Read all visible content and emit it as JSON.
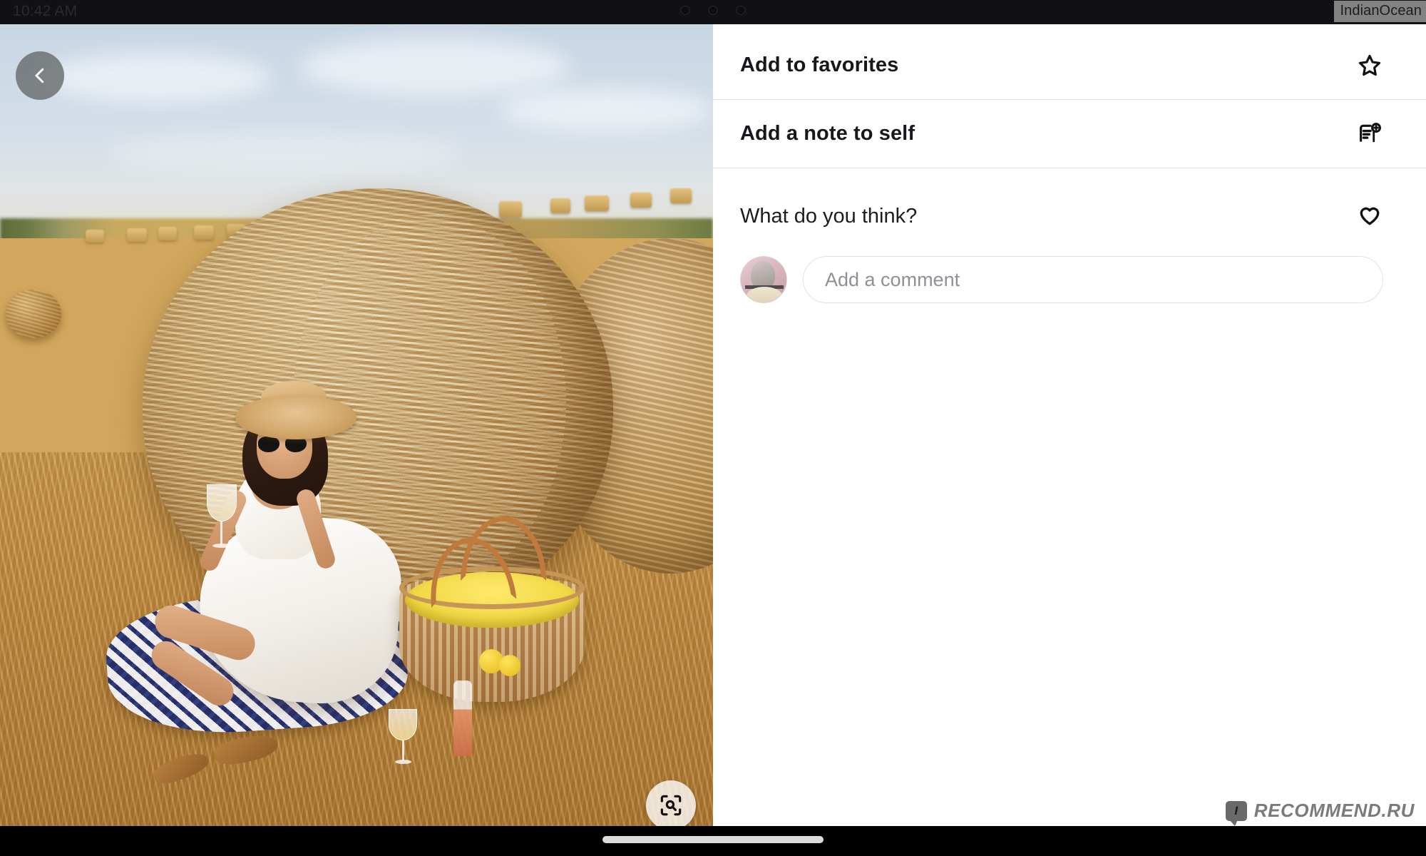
{
  "status_bar": {
    "time": "10:42 AM",
    "carrier": "IndianOcean",
    "camera_dots": 3
  },
  "photo": {
    "alt_description": "Woman in a white dress and straw hat sitting with a wine glass beside a large round hay bale in a golden wheat field",
    "back_button_icon": "chevron-left-icon",
    "lens_button_icon": "visual-search-icon"
  },
  "details_panel": {
    "menu_items": [
      {
        "label": "Add to favorites",
        "icon": "star-outline-icon"
      },
      {
        "label": "Add a note to self",
        "icon": "note-add-icon"
      }
    ],
    "comment_section": {
      "prompt": "What do you think?",
      "like_icon": "heart-outline-icon",
      "avatar_icon": "user-avatar",
      "input_placeholder": "Add a comment",
      "input_value": ""
    }
  },
  "nav_bar": {
    "gesture_pill": "home-gesture-pill"
  },
  "watermark": {
    "badge_letter": "I",
    "text": "RECOMMEND.RU"
  }
}
